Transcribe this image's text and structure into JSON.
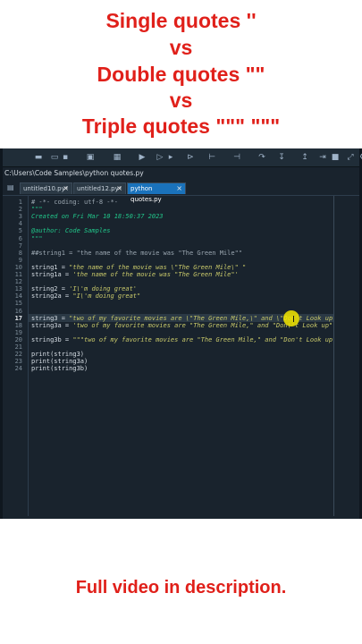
{
  "header": {
    "line1": "Single quotes ''",
    "line2": "vs",
    "line3": "Double quotes \"\"",
    "line4": "vs",
    "line5": "Triple quotes \"\"\" \"\"\"",
    "text_color": "#e0201a"
  },
  "editor": {
    "path": "C:\\Users\\Code Samples\\python quotes.py",
    "toolbar_icons": [
      "new-file-icon",
      "open-folder-icon",
      "save-icon",
      "save-all-icon",
      "new-cell-icon",
      "run-icon",
      "run-file-icon",
      "run-cell-icon",
      "run-cell-advance-icon",
      "run-selection-icon",
      "debug-icon",
      "step-icon",
      "step-into-icon",
      "step-return-icon",
      "continue-icon",
      "stop-icon",
      "maximize-icon",
      "preferences-icon"
    ],
    "tabs": [
      {
        "label": "untitled10.py*",
        "active": false
      },
      {
        "label": "untitled12.py*",
        "active": false
      },
      {
        "label": "python quotes.py",
        "active": true
      }
    ],
    "current_line": "17",
    "lines": [
      {
        "n": "1",
        "text": "# -*- coding: utf-8 -*-",
        "kind": "com"
      },
      {
        "n": "2",
        "text": "\"\"\"",
        "kind": "doc"
      },
      {
        "n": "3",
        "text": "Created on Fri Mar 10 18:50:37 2023",
        "kind": "doc"
      },
      {
        "n": "4",
        "text": "",
        "kind": "doc"
      },
      {
        "n": "5",
        "text": "@author: Code Samples",
        "kind": "doc"
      },
      {
        "n": "6",
        "text": "\"\"\"",
        "kind": "doc"
      },
      {
        "n": "7",
        "text": "",
        "kind": "code"
      },
      {
        "n": "8",
        "text": "##string1 = \"the name of the movie was \"The Green Mile\"\"",
        "kind": "com"
      },
      {
        "n": "9",
        "text": "",
        "kind": "code"
      },
      {
        "n": "10",
        "pre": "string1 = ",
        "str": "\"the name of the movie was \\\"The Green Mile\\\" \"",
        "kind": "mixed"
      },
      {
        "n": "11",
        "pre": "string1a = ",
        "str": "'the name of the movie was \"The Green Mile\"'",
        "kind": "mixed"
      },
      {
        "n": "12",
        "text": "",
        "kind": "code"
      },
      {
        "n": "13",
        "pre": "string2 = ",
        "str": "'I\\'m doing great'",
        "kind": "mixed"
      },
      {
        "n": "14",
        "pre": "string2a = ",
        "str": "\"I\\'m doing great\"",
        "kind": "mixed"
      },
      {
        "n": "15",
        "text": "",
        "kind": "code"
      },
      {
        "n": "16",
        "text": "",
        "kind": "code"
      },
      {
        "n": "17",
        "pre": "string3 = ",
        "str": "\"two of my favorite movies are \\\"The Green Mile,\\\" and \\\"Don't Look up\\\" \"",
        "kind": "mixed"
      },
      {
        "n": "18",
        "pre": "string3a = ",
        "str": "'two of my favorite movies are \"The Green Mile,\" and \"Don\\'t Look up\" '",
        "kind": "mixed"
      },
      {
        "n": "19",
        "text": "",
        "kind": "code"
      },
      {
        "n": "20",
        "pre": "string3b = ",
        "str": "\"\"\"two of my favorite movies are \"The Green Mile,\" and \"Don't Look up\" \"\"\"",
        "kind": "mixed"
      },
      {
        "n": "21",
        "text": "",
        "kind": "code"
      },
      {
        "n": "22",
        "text": "print(string3)",
        "kind": "code"
      },
      {
        "n": "23",
        "text": "print(string3a)",
        "kind": "code"
      },
      {
        "n": "24",
        "text": "print(string3b)",
        "kind": "code"
      }
    ]
  },
  "footer": {
    "text": "Full video in description."
  }
}
